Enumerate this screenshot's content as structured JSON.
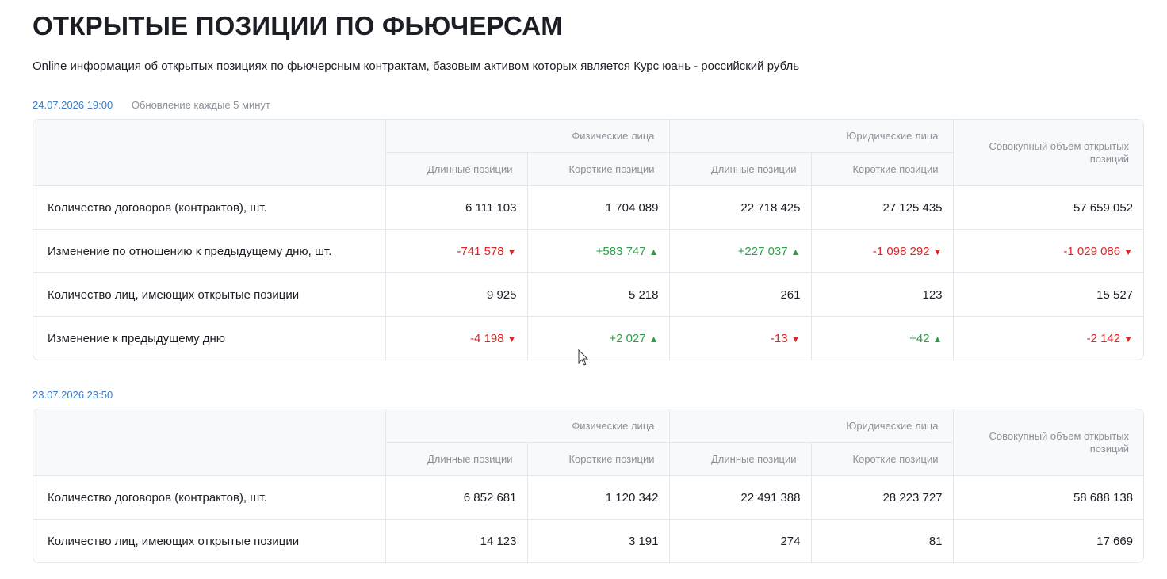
{
  "page": {
    "title": "ОТКРЫТЫЕ ПОЗИЦИИ ПО ФЬЮЧЕРСАМ",
    "subtitle": "Online информация об открытых позициях по фьючерсным контрактам, базовым активом которых является Курс юань - российский рубль"
  },
  "colors": {
    "negative": "#e02525",
    "positive": "#2e9e46",
    "accent": "#3a7bc8"
  },
  "headers": {
    "physical": "Физические лица",
    "legal": "Юридические лица",
    "long": "Длинные позиции",
    "short": "Короткие позиции",
    "total": "Совокупный объем открытых позиций"
  },
  "current": {
    "date": "24.07.2026 19:00",
    "update_note": "Обновление каждые 5 минут",
    "rows": [
      {
        "label": "Количество договоров (контрактов), шт.",
        "values": [
          "6 111 103",
          "1 704 089",
          "22 718 425",
          "27 125 435",
          "57 659 052"
        ]
      },
      {
        "label": "Изменение по отношению к предыдущему дню, шт.",
        "values": [
          "-741 578",
          "+583 747",
          "+227 037",
          "-1 098 292",
          "-1 029 086"
        ]
      },
      {
        "label": "Количество лиц, имеющих открытые позиции",
        "values": [
          "9 925",
          "5 218",
          "261",
          "123",
          "15 527"
        ]
      },
      {
        "label": "Изменение к предыдущему дню",
        "values": [
          "-4 198",
          "+2 027",
          "-13",
          "+42",
          "-2 142"
        ]
      }
    ]
  },
  "previous": {
    "date": "23.07.2026 23:50",
    "rows": [
      {
        "label": "Количество договоров (контрактов), шт.",
        "values": [
          "6 852 681",
          "1 120 342",
          "22 491 388",
          "28 223 727",
          "58 688 138"
        ]
      },
      {
        "label": "Количество лиц, имеющих открытые позиции",
        "values": [
          "14 123",
          "3 191",
          "274",
          "81",
          "17 669"
        ]
      }
    ]
  }
}
